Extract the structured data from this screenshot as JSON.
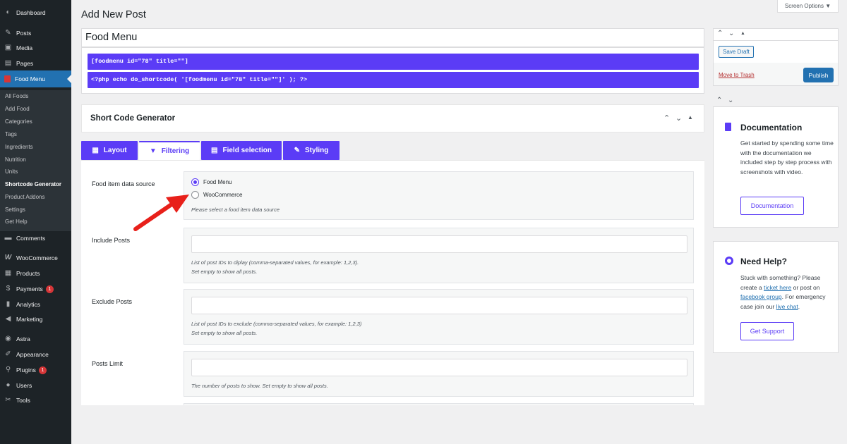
{
  "sidebar": {
    "top_items": [
      {
        "label": "Dashboard",
        "icon": "dashboard-icon"
      },
      {
        "label": "Posts",
        "icon": "pin-icon"
      },
      {
        "label": "Media",
        "icon": "media-icon"
      },
      {
        "label": "Pages",
        "icon": "pages-icon"
      },
      {
        "label": "Food Menu",
        "icon": "food-menu-icon"
      }
    ],
    "submenu": [
      "All Foods",
      "Add Food",
      "Categories",
      "Tags",
      "Ingredients",
      "Nutrition",
      "Units",
      "Shortcode Generator",
      "Product Addons",
      "Settings",
      "Get Help"
    ],
    "bottom_items": [
      {
        "label": "Comments",
        "icon": "comment-icon"
      },
      {
        "label": "WooCommerce",
        "icon": "woocommerce-icon"
      },
      {
        "label": "Products",
        "icon": "products-icon"
      },
      {
        "label": "Payments",
        "icon": "payments-icon",
        "badge": "1"
      },
      {
        "label": "Analytics",
        "icon": "analytics-icon"
      },
      {
        "label": "Marketing",
        "icon": "marketing-icon"
      },
      {
        "label": "Astra",
        "icon": "astra-icon"
      },
      {
        "label": "Appearance",
        "icon": "appearance-icon"
      },
      {
        "label": "Plugins",
        "icon": "plugins-icon",
        "badge": "1"
      },
      {
        "label": "Users",
        "icon": "users-icon"
      },
      {
        "label": "Tools",
        "icon": "tools-icon"
      }
    ]
  },
  "header": {
    "page_title": "Add New Post",
    "screen_options": "Screen Options ▼"
  },
  "post": {
    "title": "Food Menu",
    "shortcode": "[foodmenu id=\"78\" title=\"\"]",
    "php_code": "<?php echo do_shortcode( '[foodmenu id=\"78\" title=\"\"]' ); ?>"
  },
  "generator": {
    "title": "Short Code Generator",
    "tabs": [
      {
        "label": "Layout",
        "icon": "layout-icon"
      },
      {
        "label": "Filtering",
        "icon": "filter-icon"
      },
      {
        "label": "Field selection",
        "icon": "table-icon"
      },
      {
        "label": "Styling",
        "icon": "brush-icon"
      }
    ],
    "active_tab": "Filtering",
    "data_source": {
      "label": "Food item data source",
      "options": [
        "Food Menu",
        "WooCommerce"
      ],
      "selected": "Food Menu",
      "help": "Please select a food item data source"
    },
    "include_posts": {
      "label": "Include Posts",
      "value": "",
      "help1": "List of post IDs to diplay (comma-separated values, for example: 1,2,3).",
      "help2": "Set empty to show all posts."
    },
    "exclude_posts": {
      "label": "Exclude Posts",
      "value": "",
      "help1": "List of post IDs to exclude (comma-separated values, for example: 1,2,3)",
      "help2": "Set empty to show all posts."
    },
    "posts_limit": {
      "label": "Posts Limit",
      "value": "",
      "help": "The number of posts to show. Set empty to show all posts."
    }
  },
  "publish_box": {
    "save_draft": "Save Draft",
    "move_to_trash": "Move to Trash",
    "publish": "Publish"
  },
  "documentation": {
    "heading": "Documentation",
    "text": "Get started by spending some time with the documentation we included step by step process with screenshots with video.",
    "button": "Documentation"
  },
  "need_help": {
    "heading": "Need Help?",
    "text1": "Stuck with something? Please create a ",
    "link1": "ticket here",
    "text2": " or post on ",
    "link2": "facebook group",
    "text3": ". For emergency case join our ",
    "link3": "live chat",
    "text4": ".",
    "button": "Get Support"
  },
  "colors": {
    "accent": "#5b3cf6",
    "wp_blue": "#2271b1",
    "sidebar_bg": "#1d2327",
    "arrow": "#e8201a"
  }
}
